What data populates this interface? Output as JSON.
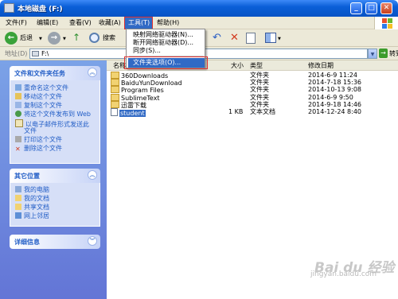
{
  "window": {
    "title": "本地磁盘 (F:)"
  },
  "menubar": {
    "items": [
      "文件(F)",
      "编辑(E)",
      "查看(V)",
      "收藏(A)",
      "工具(T)",
      "帮助(H)"
    ]
  },
  "toolbar": {
    "back_label": "后退",
    "search_label": "搜索"
  },
  "address": {
    "label": "地址(D)",
    "value": "F:\\",
    "go_label": "转到"
  },
  "tools_menu": {
    "items": [
      "映射网络驱动器(N)...",
      "断开网络驱动器(D)...",
      "同步(S)..."
    ],
    "selected": "文件夹选项(O)..."
  },
  "file_tasks": {
    "title": "文件和文件夹任务",
    "items": [
      "重命名这个文件",
      "移动这个文件",
      "复制这个文件",
      "将这个文件发布到 Web",
      "以电子邮件形式发送此",
      "文件",
      "打印这个文件",
      "删除这个文件"
    ]
  },
  "other_places": {
    "title": "其它位置",
    "items": [
      "我的电脑",
      "我的文档",
      "共享文档",
      "网上邻居"
    ]
  },
  "details": {
    "title": "详细信息"
  },
  "columns": {
    "name": "名称",
    "size": "大小",
    "type": "类型",
    "modified": "修改日期"
  },
  "files": [
    {
      "name": "360Downloads",
      "size": "",
      "type": "文件夹",
      "modified": "2014-6-9 11:24",
      "kind": "folder"
    },
    {
      "name": "BaiduYunDownload",
      "size": "",
      "type": "文件夹",
      "modified": "2014-7-18 15:36",
      "kind": "folder"
    },
    {
      "name": "Program Files",
      "size": "",
      "type": "文件夹",
      "modified": "2014-10-13 9:08",
      "kind": "folder"
    },
    {
      "name": "SublimeText",
      "size": "",
      "type": "文件夹",
      "modified": "2014-6-9 9:50",
      "kind": "folder"
    },
    {
      "name": "迅雷下载",
      "size": "",
      "type": "文件夹",
      "modified": "2014-9-18 14:46",
      "kind": "folder"
    },
    {
      "name": "student",
      "size": "1 KB",
      "type": "文本文档",
      "modified": "2014-12-24 8:40",
      "kind": "file"
    }
  ],
  "watermark": {
    "logo": "Bai du 经验",
    "url": "jingyan.baidu.com"
  },
  "colors": {
    "accent": "#316ac5",
    "title_bar": "#0a5fd8",
    "highlight_border": "#e03030"
  }
}
